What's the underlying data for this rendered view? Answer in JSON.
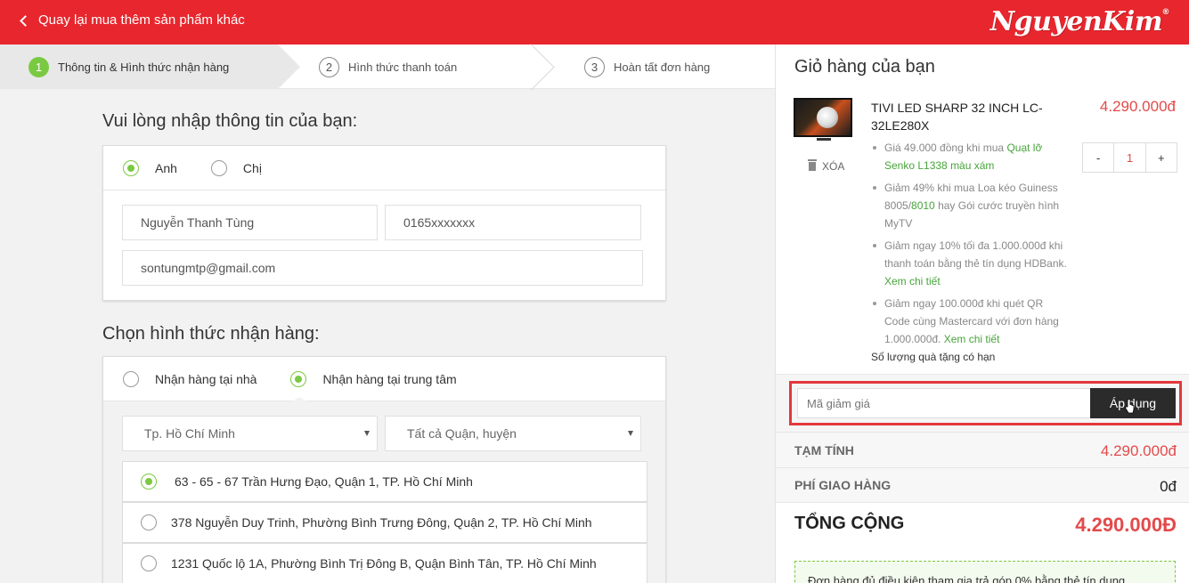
{
  "header": {
    "back_label": "Quay lại mua thêm sản phẩm khác",
    "logo_text": "NguyenKim",
    "logo_mark": "®"
  },
  "steps": [
    {
      "num": "1",
      "label": "Thông tin & Hình thức nhận hàng",
      "active": true
    },
    {
      "num": "2",
      "label": "Hình thức thanh toán",
      "active": false
    },
    {
      "num": "3",
      "label": "Hoàn tất đơn hàng",
      "active": false
    }
  ],
  "info": {
    "title": "Vui lòng nhập thông tin của bạn:",
    "gender_options": [
      {
        "label": "Anh",
        "selected": true
      },
      {
        "label": "Chị",
        "selected": false
      }
    ],
    "name_value": "Nguyễn Thanh Tùng",
    "phone_value": "0165xxxxxxx",
    "email_value": "sontungmtp@gmail.com"
  },
  "delivery": {
    "title": "Chọn hình thức nhận hàng:",
    "options": [
      {
        "label": "Nhận hàng tại nhà",
        "selected": false
      },
      {
        "label": "Nhận hàng tại trung tâm",
        "selected": true
      }
    ],
    "city_select": "Tp. Hồ Chí Minh",
    "district_select": "Tất cả Quận, huyện",
    "addresses": [
      {
        "text": "63 - 65 - 67 Trần Hưng Đạo, Quận 1, TP. Hồ Chí Minh",
        "selected": true
      },
      {
        "text": "378 Nguyễn Duy Trinh, Phường Bình Trưng Đông, Quận 2, TP. Hồ Chí Minh",
        "selected": false
      },
      {
        "text": "1231 Quốc lộ 1A, Phường Bình Trị Đông B, Quận Bình Tân, TP. Hồ Chí Minh",
        "selected": false
      }
    ]
  },
  "cart": {
    "title": "Giỏ hàng của bạn",
    "product": {
      "name": "TIVI LED SHARP 32 INCH LC-32LE280X",
      "price": "4.290.000đ",
      "remove_label": "XÓA",
      "qty": "1",
      "minus": "-",
      "plus": "+"
    },
    "promos": [
      {
        "pre": "Giá 49.000 đồng khi mua ",
        "link": "Quạt lỡ Senko L1338 màu xám",
        "post": ""
      },
      {
        "pre": "Giảm 49% khi mua Loa kéo Guiness 8005/",
        "link": "8010",
        "post": " hay Gói cước truyền hình MyTV"
      },
      {
        "pre": "Giảm ngay 10% tối đa 1.000.000đ khi thanh toán bằng thẻ tín dụng HDBank. ",
        "link": "Xem chi tiết",
        "post": ""
      },
      {
        "pre": "Giảm ngay 100.000đ khi quét QR Code cùng Mastercard với đơn hàng 1.000.000đ. ",
        "link": "Xem chi tiết",
        "post": ""
      }
    ],
    "gift_limit": "Số lượng quà tặng có hạn",
    "coupon_placeholder": "Mã giảm giá",
    "coupon_button": "Áp dụng",
    "subtotal_label": "TẠM TÍNH",
    "subtotal_value": "4.290.000đ",
    "shipping_label": "PHÍ GIAO HÀNG",
    "shipping_value": "0đ",
    "total_label": "TỔNG CỘNG",
    "total_value": "4.290.000Đ",
    "installment_note": "Đơn hàng đủ điều kiện tham gia trả góp 0% bằng thẻ tín dụng"
  },
  "colors": {
    "brand_red": "#e8262d",
    "accent_green": "#7ac943",
    "price_red": "#e34a4a"
  }
}
